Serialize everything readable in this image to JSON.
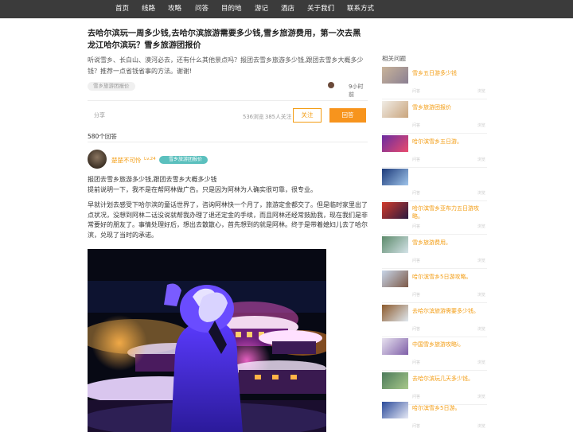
{
  "nav": [
    "首页",
    "线路",
    "攻略",
    "问答",
    "目的地",
    "游记",
    "酒店",
    "关于我们",
    "联系方式"
  ],
  "question": {
    "title": "去哈尔滨玩一周多少钱,去哈尔滨旅游需要多少钱,雪乡旅游费用，第一次去黑龙江哈尔滨玩？雪乡旅游团报价",
    "desc": "听说雪乡、长白山、漠河必去，还有什么其他景点吗？报团去雪乡旅游多少钱,跟团去雪乡大概多少钱？推荐一点省钱省事的方法。谢谢!",
    "tag": "雪乡旅游团报价",
    "time": "9小时前",
    "share": "分享",
    "views": "536浏览",
    "followers": "385人关注",
    "follow_label": "关注",
    "answer_label": "回答",
    "answer_count": "580个回答"
  },
  "answer": {
    "username": "楚楚不可怜",
    "level": "Lv.24",
    "tag": "雪乡旅游团报价",
    "p1": "报团去雪乡旅游多少钱,跟团去雪乡大概多少钱",
    "p2": "提前说明一下，我不是在帮阿林做广告。只是因为阿林为人确实很可靠，很专业。",
    "p3": "早就计划去感受下哈尔滨的童话世界了，咨询阿林快一个月了，旅游定金都交了。但是临时家里出了点状况，没想到阿林二话没说就帮我办理了退还定金的手续，而且阿林还经常鼓励我，现在我们是非常要好的朋友了。事情处理好后，想出去散散心，首先想到的就是阿林。终于是带着媳妇儿去了哈尔滨，兑现了当时的承诺。"
  },
  "sidebar": {
    "title": "相关问题",
    "items": [
      {
        "title": "雪乡五日游多少钱",
        "meta_left": "问答",
        "meta_right": "浏览",
        "colors": [
          "#c9b49a",
          "#8a7f92"
        ]
      },
      {
        "title": "雪乡旅游团报价",
        "meta_left": "问答",
        "meta_right": "浏览",
        "colors": [
          "#f0ece6",
          "#c9a47c"
        ]
      },
      {
        "title": "哈尔滨雪乡五日游。",
        "meta_left": "问答",
        "meta_right": "浏览",
        "colors": [
          "#6a2ca0",
          "#e94b6d"
        ]
      },
      {
        "title": "",
        "meta_left": "问答",
        "meta_right": "浏览",
        "colors": [
          "#1c3a7a",
          "#9fc4ea"
        ]
      },
      {
        "title": "哈尔滨雪乡亚布力五日游攻略。",
        "meta_left": "问答",
        "meta_right": "浏览",
        "colors": [
          "#d23a2a",
          "#2a1a40"
        ]
      },
      {
        "title": "雪乡旅游费用。",
        "meta_left": "问答",
        "meta_right": "浏览",
        "colors": [
          "#5c8a6a",
          "#d4e3e8"
        ]
      },
      {
        "title": "哈尔滨雪乡5日游攻略。",
        "meta_left": "问答",
        "meta_right": "浏览",
        "colors": [
          "#c7d5e8",
          "#7d5a48"
        ]
      },
      {
        "title": "去哈尔滨旅游需要多少钱。",
        "meta_left": "问答",
        "meta_right": "浏览",
        "colors": [
          "#8c5a2c",
          "#e0e8f0"
        ]
      },
      {
        "title": "中国雪乡旅游攻略i。",
        "meta_left": "问答",
        "meta_right": "浏览",
        "colors": [
          "#e7e2ef",
          "#7f5fa8"
        ]
      },
      {
        "title": "去哈尔滨玩几天多少钱。",
        "meta_left": "问答",
        "meta_right": "浏览",
        "colors": [
          "#4c7a5a",
          "#a7c88a"
        ]
      },
      {
        "title": "哈尔滨雪乡5日游。",
        "meta_left": "问答",
        "meta_right": "浏览",
        "colors": [
          "#2a4a9a",
          "#e7e9f6"
        ]
      }
    ]
  }
}
